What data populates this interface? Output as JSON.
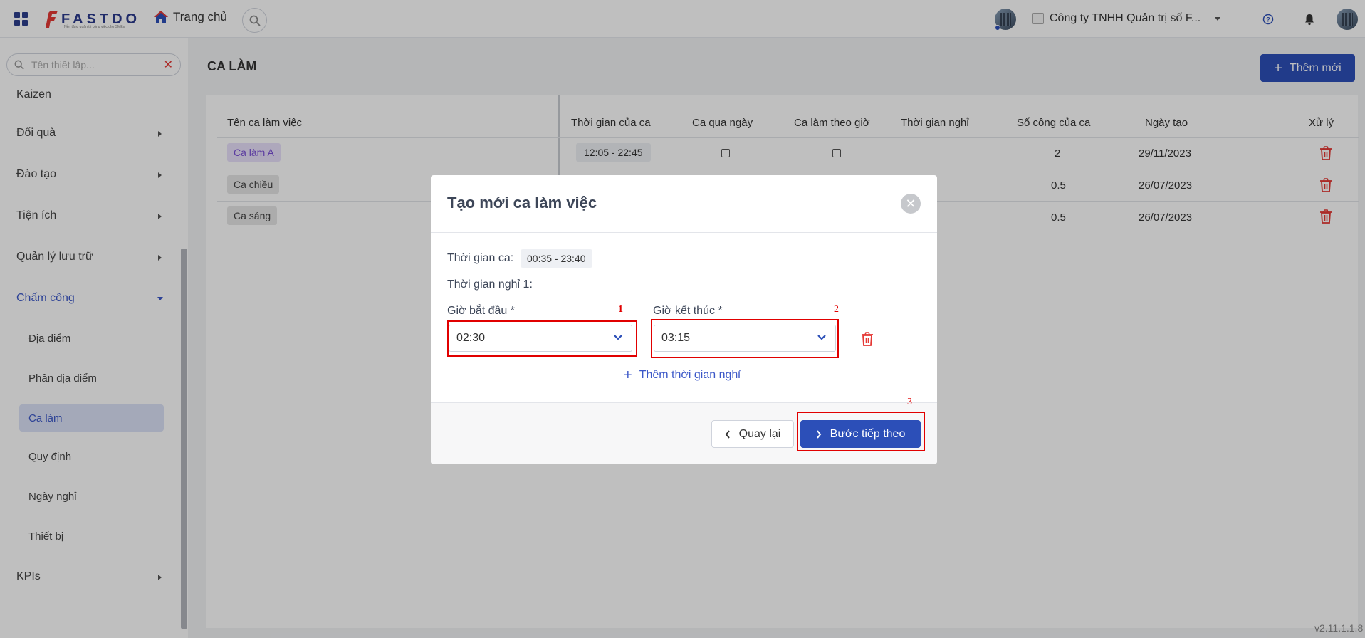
{
  "topbar": {
    "logo_text": "FASTDO",
    "logo_tagline": "Nền tảng quản trị công việc cho SMEs",
    "home_label": "Trang chủ",
    "company_name": "Công ty TNHH Quản trị số F..."
  },
  "sidebar": {
    "search_placeholder": "Tên thiết lập...",
    "items": [
      {
        "label": "Kaizen",
        "has_arrow": false
      },
      {
        "label": "Đổi quà",
        "has_arrow": true
      },
      {
        "label": "Đào tạo",
        "has_arrow": true
      },
      {
        "label": "Tiện ích",
        "has_arrow": true
      },
      {
        "label": "Quản lý lưu trữ",
        "has_arrow": true
      },
      {
        "label": "Chấm công",
        "has_arrow": true,
        "open": true
      }
    ],
    "subitems": [
      {
        "label": "Địa điểm"
      },
      {
        "label": "Phân địa điểm"
      },
      {
        "label": "Ca làm",
        "active": true
      },
      {
        "label": "Quy định"
      },
      {
        "label": "Ngày nghỉ"
      },
      {
        "label": "Thiết bị"
      }
    ],
    "last_item": {
      "label": "KPIs"
    }
  },
  "page": {
    "title": "CA LÀM",
    "add_button": "Thêm mới"
  },
  "table": {
    "headers": [
      "Tên ca làm việc",
      "Thời gian của ca",
      "Ca qua ngày",
      "Ca làm theo giờ",
      "Thời gian nghỉ",
      "Số công của ca",
      "Ngày tạo",
      "Xử lý"
    ],
    "rows": [
      {
        "name": "Ca làm A",
        "time": "12:05 - 22:45",
        "workdays": "2",
        "created": "29/11/2023"
      },
      {
        "name": "Ca chiều",
        "time": "",
        "workdays": "0.5",
        "created": "26/07/2023"
      },
      {
        "name": "Ca sáng",
        "time": "",
        "workdays": "0.5",
        "created": "26/07/2023"
      }
    ]
  },
  "modal": {
    "title": "Tạo mới ca làm việc",
    "shift_time_label": "Thời gian ca:",
    "shift_time_value": "00:35 - 23:40",
    "break_label": "Thời gian nghỉ 1:",
    "start_label": "Giờ bắt đầu *",
    "start_value": "02:30",
    "end_label": "Giờ kết thúc *",
    "end_value": "03:15",
    "add_break": "Thêm thời gian nghỉ",
    "back_button": "Quay lại",
    "next_button": "Bước tiếp theo",
    "annotations": [
      "1",
      "2",
      "3"
    ]
  },
  "version": "v2.11.1.1.8",
  "colors": {
    "primary": "#2c4fb8",
    "danger": "#e53935",
    "annotation": "#e10000"
  }
}
